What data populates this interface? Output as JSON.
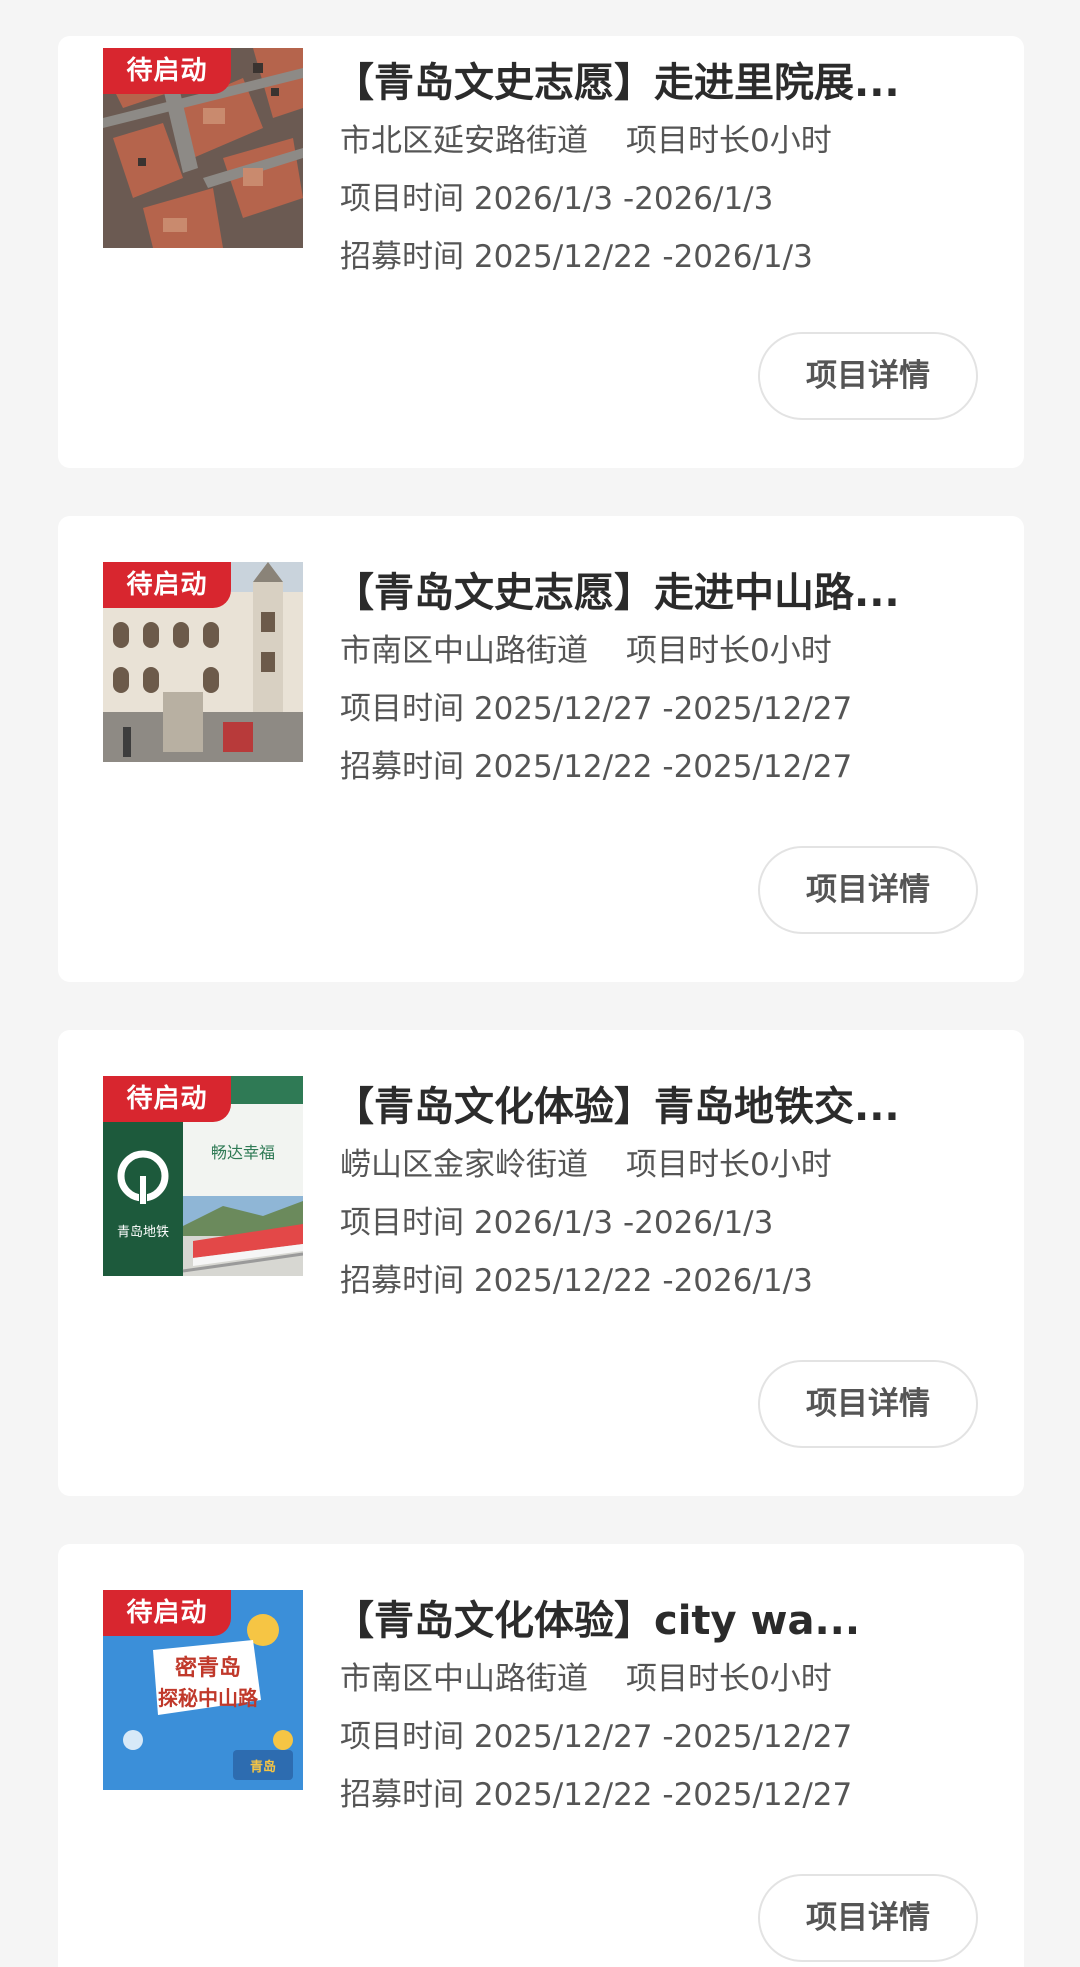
{
  "projects": [
    {
      "badge": "待启动",
      "title": "【青岛文史志愿】走进里院展...",
      "district": "市北区延安路街道",
      "duration": "项目时长0小时",
      "project_time_label": "项目时间",
      "project_time": "2026/1/3 -2026/1/3",
      "recruit_time_label": "招募时间",
      "recruit_time": "2025/12/22 -2026/1/3",
      "button": "项目详情"
    },
    {
      "badge": "待启动",
      "title": "【青岛文史志愿】走进中山路...",
      "district": "市南区中山路街道",
      "duration": "项目时长0小时",
      "project_time_label": "项目时间",
      "project_time": "2025/12/27 -2025/12/27",
      "recruit_time_label": "招募时间",
      "recruit_time": "2025/12/22 -2025/12/27",
      "button": "项目详情"
    },
    {
      "badge": "待启动",
      "title": "【青岛文化体验】青岛地铁交...",
      "district": "崂山区金家岭街道",
      "duration": "项目时长0小时",
      "project_time_label": "项目时间",
      "project_time": "2026/1/3 -2026/1/3",
      "recruit_time_label": "招募时间",
      "recruit_time": "2025/12/22 -2026/1/3",
      "button": "项目详情",
      "thumb_text": {
        "logo_caption": "青岛地铁",
        "slogan": "畅达幸福"
      }
    },
    {
      "badge": "待启动",
      "title": "【青岛文化体验】city wa...",
      "district": "市南区中山路街道",
      "duration": "项目时长0小时",
      "project_time_label": "项目时间",
      "project_time": "2025/12/27 -2025/12/27",
      "recruit_time_label": "招募时间",
      "recruit_time": "2025/12/22 -2025/12/27",
      "button": "项目详情",
      "thumb_text": {
        "poster_line1": "密青岛",
        "poster_line2": "探秘中山路",
        "poster_corner": "青岛"
      }
    }
  ],
  "colors": {
    "badge": "#d8262f",
    "page_bg": "#f5f5f5",
    "card_bg": "#ffffff",
    "title": "#2b2b2b",
    "meta": "#555555"
  },
  "icons": [
    "thumbnail-aerial-rooftops",
    "thumbnail-historic-building",
    "thumbnail-qingdao-metro",
    "thumbnail-city-walk-poster"
  ]
}
